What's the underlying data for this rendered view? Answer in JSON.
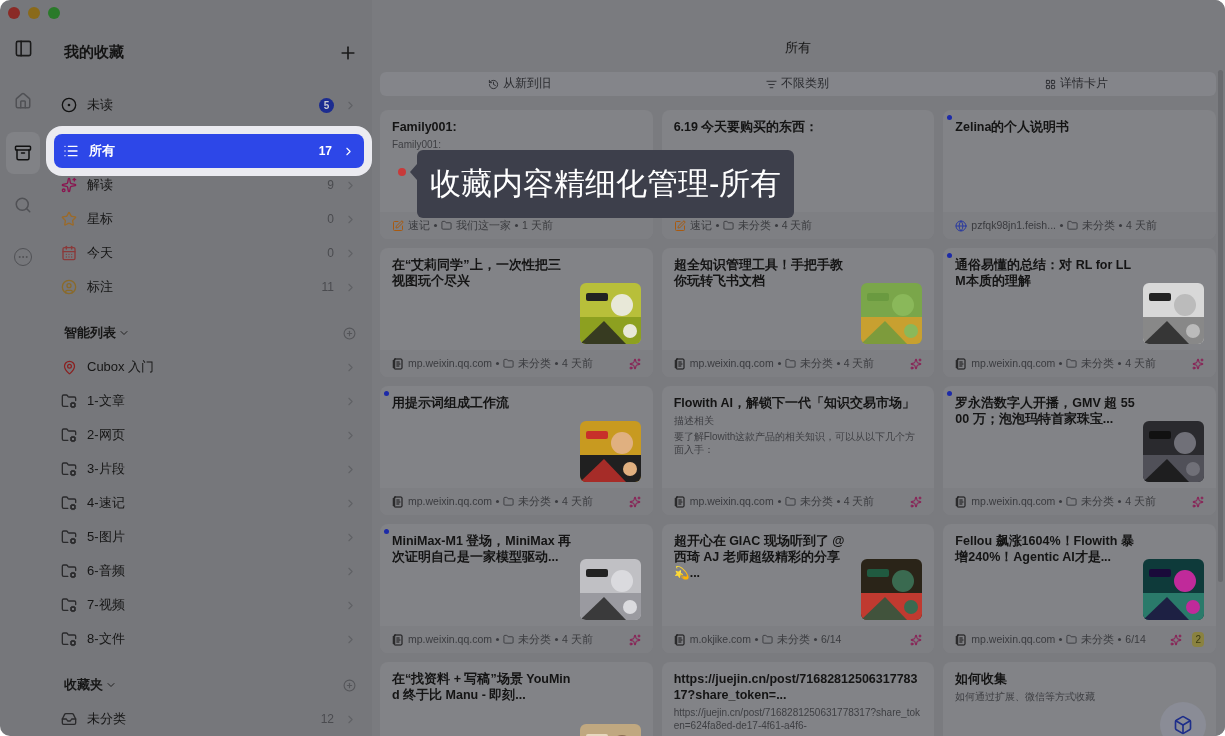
{
  "rail": [
    {
      "kind": "home",
      "selected": false
    },
    {
      "kind": "box",
      "selected": true
    },
    {
      "kind": "search",
      "selected": false
    },
    {
      "kind": "more",
      "selected": false
    }
  ],
  "sidebar": {
    "title": "我的收藏",
    "items": [
      {
        "kind": "unread",
        "label": "未读",
        "count": "5",
        "selected": false
      },
      {
        "kind": "all",
        "label": "所有",
        "count": "17",
        "selected": true
      },
      {
        "kind": "ai",
        "label": "解读",
        "count": "9",
        "selected": false
      },
      {
        "kind": "star",
        "label": "星标",
        "count": "0",
        "selected": false
      },
      {
        "kind": "today",
        "label": "今天",
        "count": "0",
        "selected": false
      },
      {
        "kind": "highlight",
        "label": "标注",
        "count": "11",
        "selected": false
      }
    ],
    "sections": [
      {
        "title": "智能列表",
        "items": [
          {
            "kind": "pin",
            "label": "Cubox 入门"
          },
          {
            "kind": "folder",
            "label": "1-文章"
          },
          {
            "kind": "folder",
            "label": "2-网页"
          },
          {
            "kind": "folder",
            "label": "3-片段"
          },
          {
            "kind": "folder",
            "label": "4-速记"
          },
          {
            "kind": "folder",
            "label": "5-图片"
          },
          {
            "kind": "folder",
            "label": "6-音频"
          },
          {
            "kind": "folder",
            "label": "7-视频"
          },
          {
            "kind": "folder",
            "label": "8-文件"
          }
        ]
      },
      {
        "title": "收藏夹",
        "items": [
          {
            "kind": "inbox",
            "label": "未分类",
            "count": "12"
          }
        ]
      }
    ]
  },
  "main": {
    "title": "所有",
    "toolbar": [
      {
        "kind": "sort",
        "label": "从新到旧"
      },
      {
        "kind": "filter",
        "label": "不限类别"
      },
      {
        "kind": "view",
        "label": "详情卡片"
      }
    ],
    "cards": [
      {
        "title": "Family001:",
        "snippets": [
          "Family001:"
        ],
        "source": {
          "kind": "note",
          "label": "速记"
        },
        "folder": "我们这一家",
        "time": "1 天前",
        "unread": false,
        "ai": false
      },
      {
        "title": "6.19 今天要购买的东西：",
        "source": {
          "kind": "note",
          "label": "速记"
        },
        "folder": "未分类",
        "time": "4 天前",
        "unread": false,
        "ai": false
      },
      {
        "title": "Zelina的个人说明书",
        "source": {
          "kind": "web",
          "label": "pzfqk98jn1.feish..."
        },
        "folder": "未分类",
        "time": "4 天前",
        "unread": true,
        "ai": false
      },
      {
        "title": "在“艾莉同学”上，一次性把三视图玩个尽兴",
        "source": {
          "kind": "article",
          "label": "mp.weixin.qq.com"
        },
        "folder": "未分类",
        "time": "4 天前",
        "unread": false,
        "ai": true
      },
      {
        "title": "超全知识管理工具！手把手教你玩转飞书文档",
        "source": {
          "kind": "article",
          "label": "mp.weixin.qq.com"
        },
        "folder": "未分类",
        "time": "4 天前",
        "unread": false,
        "ai": true
      },
      {
        "title": "通俗易懂的总结：对 RL for LLM本质的理解",
        "source": {
          "kind": "article",
          "label": "mp.weixin.qq.com"
        },
        "folder": "未分类",
        "time": "4 天前",
        "unread": true,
        "ai": true
      },
      {
        "title": "用提示词组成工作流",
        "source": {
          "kind": "article",
          "label": "mp.weixin.qq.com"
        },
        "folder": "未分类",
        "time": "4 天前",
        "unread": true,
        "ai": true
      },
      {
        "title": "Flowith AI，解锁下一代「知识交易市场」",
        "snippets": [
          "描述相关",
          "要了解Flowith这款产品的相关知识，可以从以下几个方面入手："
        ],
        "source": {
          "kind": "article",
          "label": "mp.weixin.qq.com"
        },
        "folder": "未分类",
        "time": "4 天前",
        "unread": false,
        "ai": true
      },
      {
        "title": "罗永浩数字人开播，GMV 超 5500 万；泡泡玛特首家珠宝...",
        "source": {
          "kind": "article",
          "label": "mp.weixin.qq.com"
        },
        "folder": "未分类",
        "time": "4 天前",
        "unread": true,
        "ai": true
      },
      {
        "title": "MiniMax-M1 登场，MiniMax 再次证明自己是一家模型驱动...",
        "source": {
          "kind": "article",
          "label": "mp.weixin.qq.com"
        },
        "folder": "未分类",
        "time": "4 天前",
        "unread": true,
        "ai": true
      },
      {
        "title": "超开心在 GIAC 现场听到了 @ 西琦 AJ 老师超级精彩的分享💫...",
        "source": {
          "kind": "article",
          "label": "m.okjike.com"
        },
        "folder": "未分类",
        "time": "6/14",
        "unread": false,
        "ai": true
      },
      {
        "title": "Fellou 飙涨1604%！Flowith 暴增240%！Agentic AI才是...",
        "source": {
          "kind": "article",
          "label": "mp.weixin.qq.com"
        },
        "folder": "未分类",
        "time": "6/14",
        "unread": false,
        "ai": true,
        "badge": "2"
      },
      {
        "title": "在“找资料 + 写稿”场景 YouMind 终于比 Manu - 即刻...",
        "unread": false,
        "ai": false
      },
      {
        "title": "https://juejin.cn/post/7168281250631778317?share_token=...",
        "snippets": [
          "https://juejin.cn/post/7168281250631778317?share_token=624fa8ed-de17-4f61-a4f6-"
        ],
        "unread": false,
        "ai": false
      },
      {
        "title": "如何收集",
        "snippets": [
          "如何通过扩展、微信等方式收藏"
        ],
        "unread": false,
        "ai": false
      }
    ]
  },
  "tooltip": {
    "text": "收藏内容精细化管理-所有"
  }
}
